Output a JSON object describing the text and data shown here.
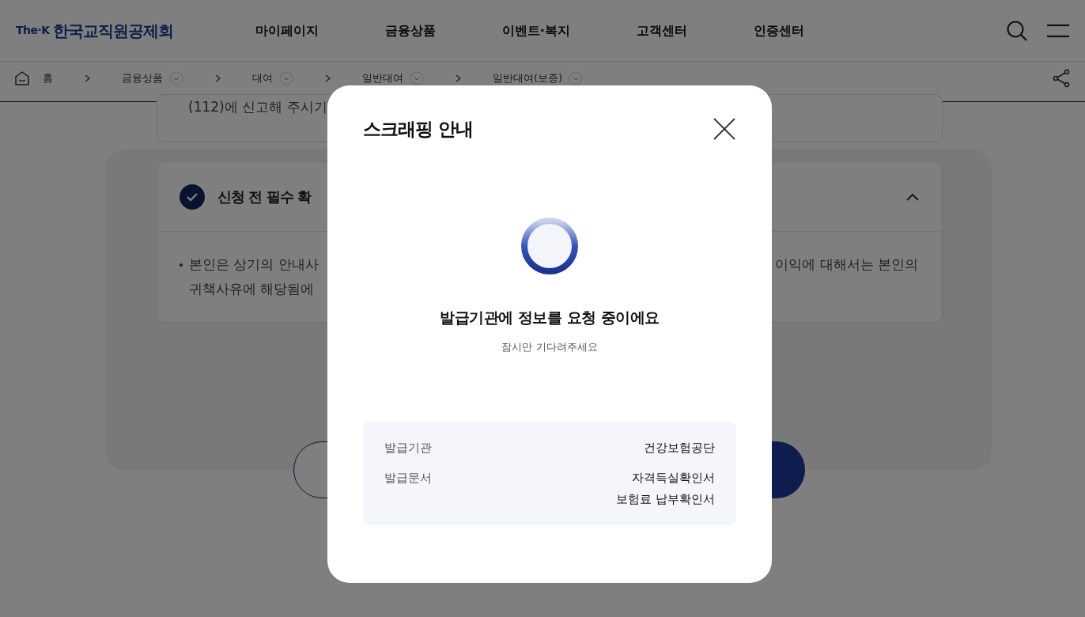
{
  "header": {
    "logo": {
      "mark": "The·K",
      "name": "한국교직원공제회"
    },
    "nav": [
      "마이페이지",
      "금융상품",
      "이벤트·복지",
      "고객센터",
      "인증센터"
    ]
  },
  "breadcrumb": [
    {
      "label": "홈",
      "kind": "home"
    },
    {
      "label": "금융상품",
      "kind": "dropdown"
    },
    {
      "label": "대여",
      "kind": "dropdown"
    },
    {
      "label": "일반대여",
      "kind": "dropdown"
    },
    {
      "label": "일반대여(보증)",
      "kind": "dropdown"
    }
  ],
  "content": {
    "notice_fragment": "(112)에 신고해 주시기",
    "section": {
      "title": "신청 전 필수 확",
      "checked": true,
      "expanded": true,
      "body_left": [
        "본인은 상기의 안내사",
        "귀책사유에 해당됨에"
      ],
      "body_right": [
        "이익에 대해서는 본인의"
      ]
    }
  },
  "modal": {
    "title": "스크래핑 안내",
    "heading": "발급기관에 정보를 요청 중이에요",
    "subtext": "잠시만 기다려주세요",
    "info": [
      {
        "label": "발급기관",
        "values": [
          "건강보험공단"
        ]
      },
      {
        "label": "발급문서",
        "values": [
          "자격득실확인서",
          "보험료 납부확인서"
        ]
      }
    ]
  }
}
